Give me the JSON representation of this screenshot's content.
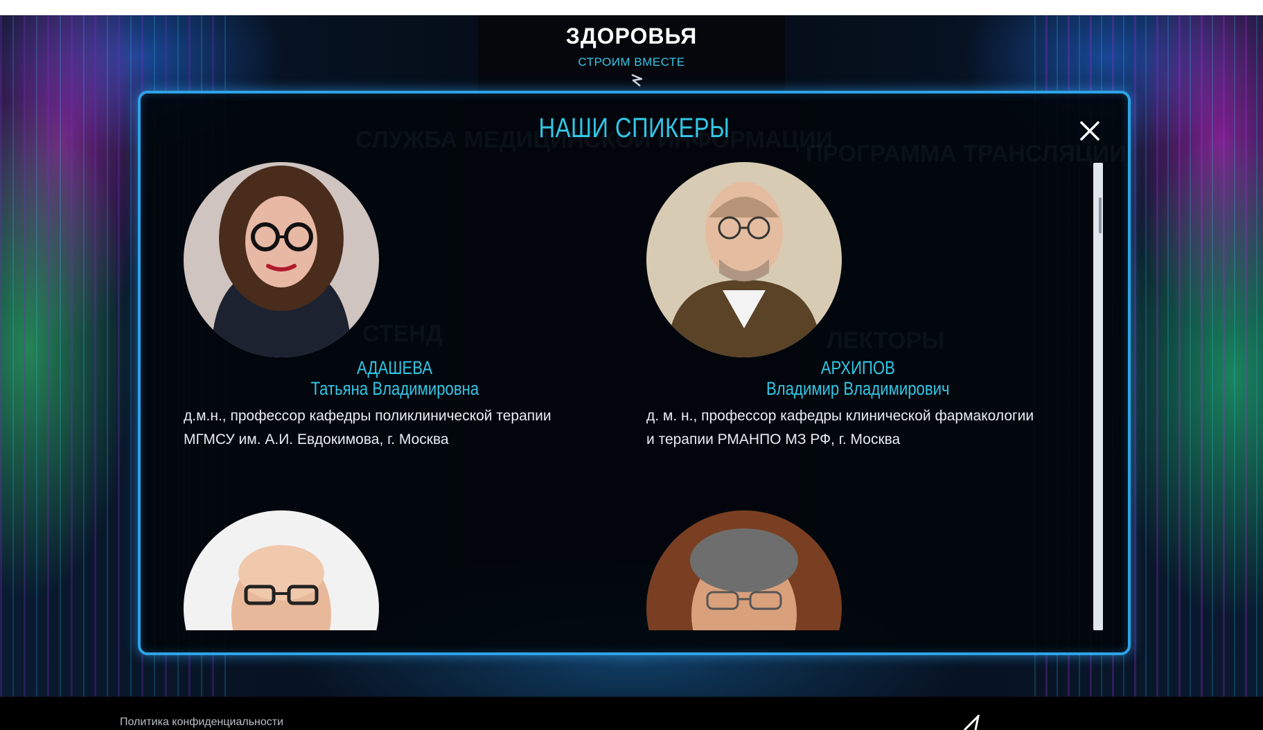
{
  "header": {
    "title": "ЗДОРОВЬЯ",
    "subtitle": "СТРОИМ ВМЕСТЕ"
  },
  "background_labels": [
    "СЛУЖБА МЕДИЦИНСКОЙ ИНФОРМАЦИИ",
    "ПРОГРАММА ТРАНСЛЯЦИИ",
    "СТЕНД",
    "ЛЕКТОРЫ"
  ],
  "modal": {
    "title": "НАШИ СПИКЕРЫ",
    "close_icon": "close-icon"
  },
  "speakers": [
    {
      "surname": "АДАШЕВА",
      "name": "Татьяна Владимировна",
      "desc_line1": "д.м.н., профессор кафедры поликлинической терапии",
      "desc_line2": "МГМСУ им. А.И. Евдокимова, г. Москва"
    },
    {
      "surname": "АРХИПОВ",
      "name": "Владимир Владимирович",
      "desc_line1": "д. м. н., профессор кафедры клинической фармакологии",
      "desc_line2": "и терапии РМАНПО МЗ РФ, г. Москва"
    },
    {
      "surname": "",
      "name": "",
      "desc_line1": "",
      "desc_line2": ""
    },
    {
      "surname": "",
      "name": "",
      "desc_line1": "",
      "desc_line2": ""
    }
  ],
  "scroll": {
    "position_fraction": 0.08
  },
  "footer": {
    "privacy_link": "Политика конфиденциальности"
  },
  "colors": {
    "accent": "#33c6e6",
    "modal_border": "#2ea3e8",
    "modal_bg": "#02060c"
  }
}
